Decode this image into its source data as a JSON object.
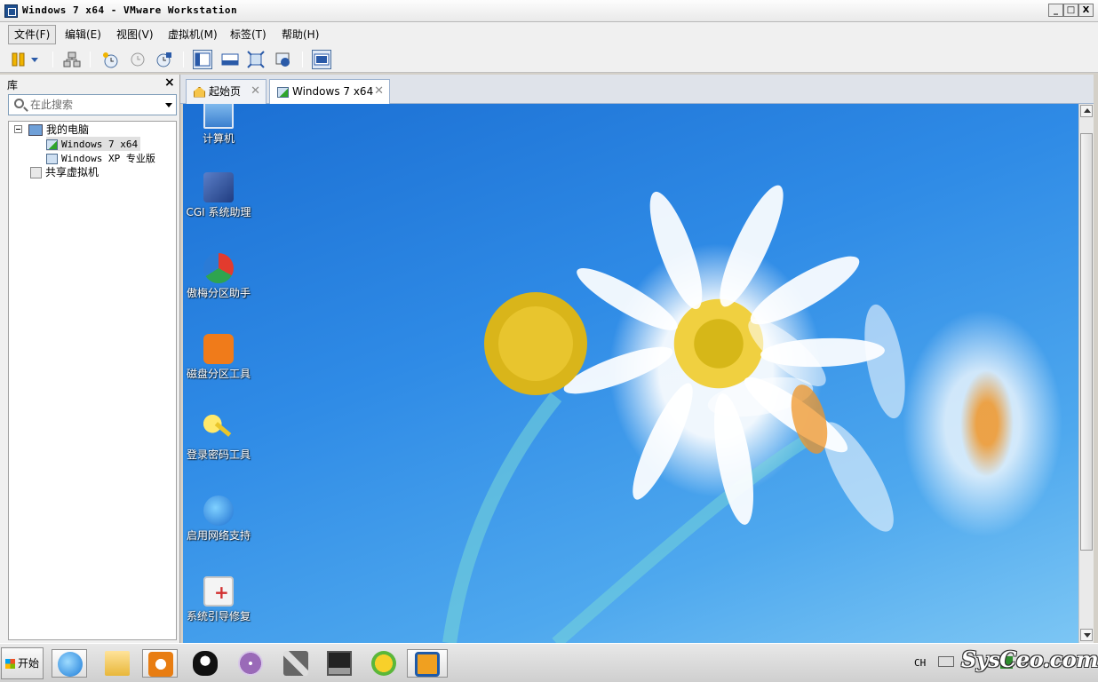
{
  "window": {
    "title": "Windows 7 x64 - VMware Workstation",
    "controls": [
      "_",
      "□",
      "X"
    ]
  },
  "menu": [
    {
      "label": "文件(F)"
    },
    {
      "label": "编辑(E)"
    },
    {
      "label": "视图(V)"
    },
    {
      "label": "虚拟机(M)"
    },
    {
      "label": "标签(T)"
    },
    {
      "label": "帮助(H)"
    }
  ],
  "toolbar": {
    "icons": [
      "pause-icon",
      "dropdown-arrow-icon",
      "network-icon",
      "snapshot-icon",
      "revert-snapshot-icon",
      "snapshot-manager-icon",
      "console-view-icon",
      "quick-switch-icon",
      "full-screen-icon",
      "unity-icon",
      "thumbnail-icon"
    ]
  },
  "sidebar": {
    "title": "库",
    "close": "×",
    "search_placeholder": "在此搜索",
    "tree": {
      "root": "我的电脑",
      "vms": [
        "Windows 7 x64",
        "Windows XP 专业版"
      ],
      "shared": "共享虚拟机"
    }
  },
  "tabs": [
    {
      "label": "起始页",
      "close": "✕",
      "icon": "home-icon"
    },
    {
      "label": "Windows 7 x64",
      "close": "✕",
      "icon": "vm-running-icon"
    }
  ],
  "desktop": {
    "icons": [
      {
        "label": "计算机",
        "icon": "computer-icon"
      },
      {
        "label": "CGI 系统助理",
        "icon": "cgi-icon"
      },
      {
        "label": "傲梅分区助手",
        "icon": "partition-assistant-icon"
      },
      {
        "label": "磁盘分区工具",
        "icon": "disk-partition-icon"
      },
      {
        "label": "登录密码工具",
        "icon": "key-icon"
      },
      {
        "label": "启用网络支持",
        "icon": "ie-icon"
      },
      {
        "label": "系统引导修复",
        "icon": "boot-repair-icon"
      }
    ]
  },
  "taskbar": {
    "start_label": "开始",
    "apps": [
      "ie-icon",
      "folder-icon",
      "media-player-icon",
      "qq-icon",
      "disc-icon",
      "tools-icon",
      "monitor-icon",
      "sync-icon",
      "vmware-icon"
    ],
    "lang": "CH",
    "watermark": "SysCeo.com"
  }
}
